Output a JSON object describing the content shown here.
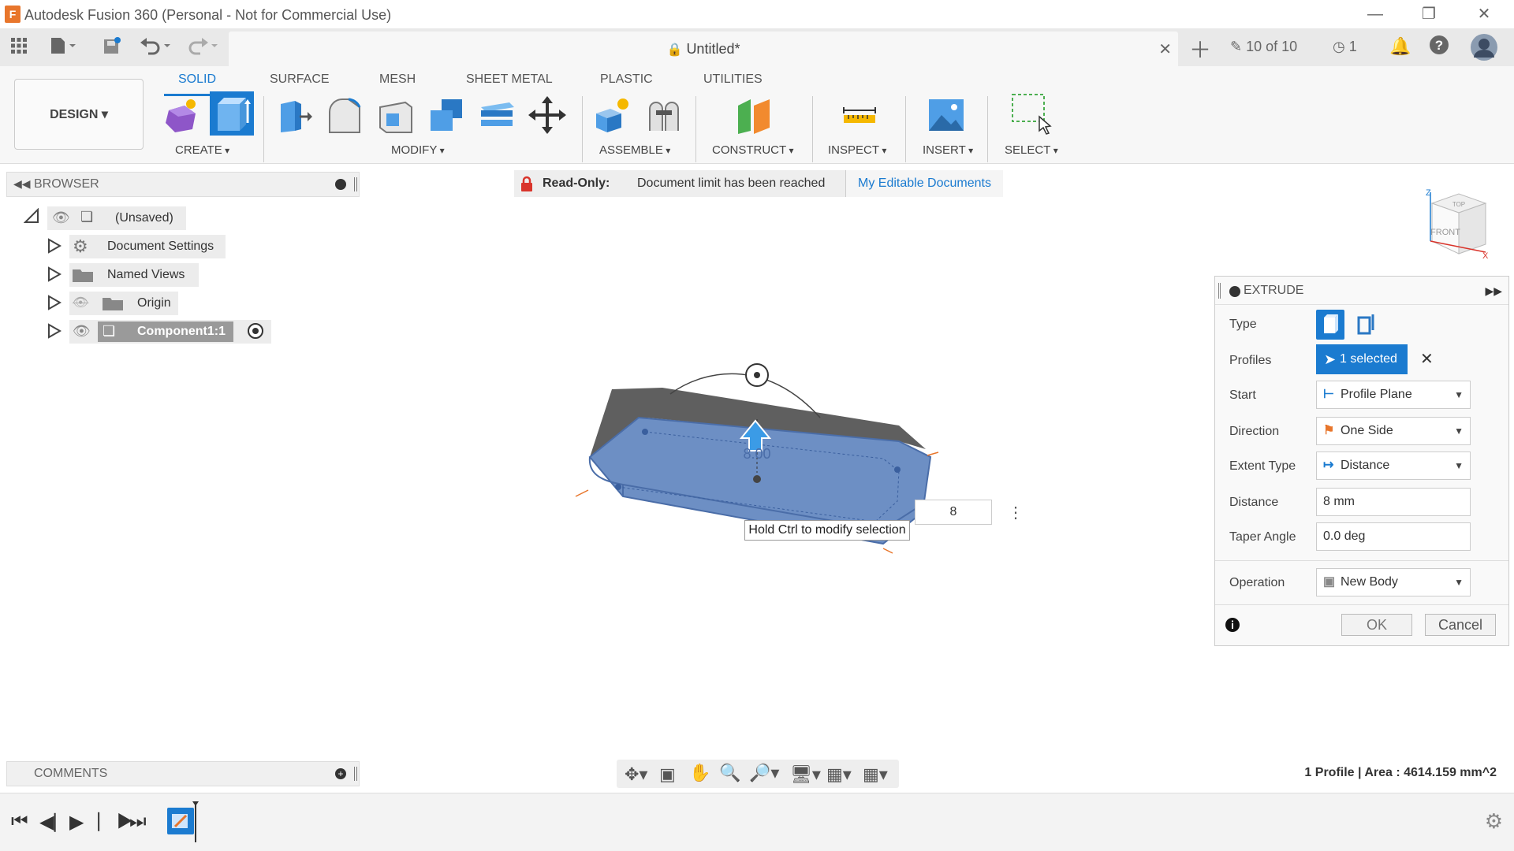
{
  "window": {
    "title": "Autodesk Fusion 360 (Personal - Not for Commercial Use)",
    "app_icon_letter": "F"
  },
  "quickbar": {
    "document_title": "Untitled*",
    "jobs": "10 of 10",
    "history_count": "1"
  },
  "toolbar": {
    "workspace": "DESIGN",
    "tabs": [
      "SOLID",
      "SURFACE",
      "MESH",
      "SHEET METAL",
      "PLASTIC",
      "UTILITIES"
    ],
    "groups": [
      "CREATE",
      "MODIFY",
      "ASSEMBLE",
      "CONSTRUCT",
      "INSPECT",
      "INSERT",
      "SELECT"
    ]
  },
  "browser": {
    "title": "BROWSER",
    "root": "(Unsaved)",
    "items": [
      {
        "label": "Document Settings",
        "icon": "gear-icon"
      },
      {
        "label": "Named Views",
        "icon": "folder-icon"
      },
      {
        "label": "Origin",
        "icon": "folder-icon"
      },
      {
        "label": "Component1:1",
        "icon": "component-icon"
      }
    ]
  },
  "banner": {
    "readonly_label": "Read-Only:",
    "message": "Document limit has been reached",
    "link": "My Editable Documents"
  },
  "canvas": {
    "distance_value": "8",
    "manipulator_text": "8.00",
    "tooltip": "Hold Ctrl to modify selection"
  },
  "viewcube": {
    "top": "TOP",
    "front": "FRONT",
    "z_axis": "Z",
    "x_axis": "X"
  },
  "extrude": {
    "title": "EXTRUDE",
    "type_label": "Type",
    "profiles_label": "Profiles",
    "profiles_value": "1 selected",
    "start_label": "Start",
    "start_value": "Profile Plane",
    "direction_label": "Direction",
    "direction_value": "One Side",
    "extent_label": "Extent Type",
    "extent_value": "Distance",
    "distance_label": "Distance",
    "distance_value": "8 mm",
    "taper_label": "Taper Angle",
    "taper_value": "0.0 deg",
    "operation_label": "Operation",
    "operation_value": "New Body",
    "ok": "OK",
    "cancel": "Cancel"
  },
  "comments": {
    "title": "COMMENTS"
  },
  "status": {
    "text": "1 Profile | Area : 4614.159 mm^2"
  },
  "colors": {
    "accent": "#1b7bd0",
    "body_blue": "#6d8fc4",
    "lock_red": "#d9342b",
    "brand_orange": "#e8762c"
  }
}
